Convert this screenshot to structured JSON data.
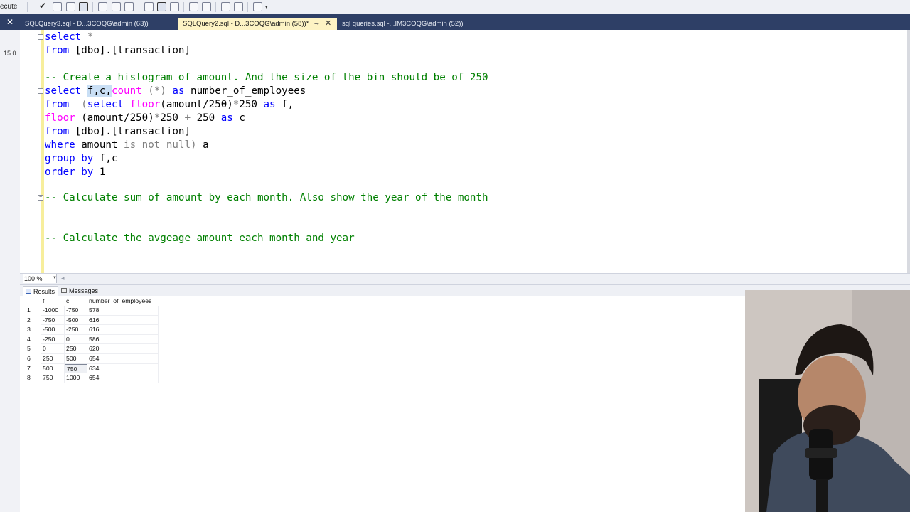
{
  "toolbar": {
    "execute_label": "ecute",
    "icons": [
      "checkmark-icon",
      "debug-icon",
      "stop-icon",
      "parse-icon",
      "display-plan-icon",
      "query-options-icon",
      "results-to-text-icon",
      "results-to-grid-icon",
      "results-to-file-icon",
      "comment-icon",
      "uncomment-icon",
      "indent-icon",
      "outdent-icon",
      "specify-values-icon"
    ]
  },
  "tabs": [
    {
      "label": "SQLQuery3.sql - D...3COQG\\admin (63))",
      "active": false
    },
    {
      "label": "SQLQuery2.sql - D...3COQG\\admin (58))*",
      "active": true
    },
    {
      "label": "sql queries.sql -...IM3COQG\\admin (52))",
      "active": false
    }
  ],
  "gutter": {
    "version_text": "15.0"
  },
  "editor": {
    "lines": {
      "l1_kw": "select",
      "l1_rest": " *",
      "l2_kw": "from",
      "l2_rest": " [dbo].[transaction]",
      "l4_comment": "-- Create a histogram of amount. And the size of the bin should be of 250",
      "l5_kw": "select",
      "l5_sel": "f,c,",
      "l5_fn": "count",
      "l5_star": " (*)",
      "l5_as": " as",
      "l5_rest": " number_of_employees",
      "l6_kw": "from",
      "l6_a": "  (",
      "l6_kw2": "select",
      "l6_fn": " floor",
      "l6_b": "(amount/250)",
      "l6_c": "*",
      "l6_d": "250",
      "l6_as": " as",
      "l6_e": " f,",
      "l7_fn": "floor",
      "l7_a": " (amount/250)",
      "l7_b": "*",
      "l7_c": "250",
      "l7_d": " +",
      "l7_e": " 250",
      "l7_as": " as",
      "l7_f": " c",
      "l8_kw": "from",
      "l8_rest": " [dbo].[transaction]",
      "l9_kw": "where",
      "l9_a": " amount",
      "l9_gr": " is not null",
      "l9_b": ")",
      "l9_c": " a",
      "l10_kw": "group by",
      "l10_rest": " f,c",
      "l11_kw": "order by",
      "l11_rest": " 1",
      "l13_comment": "-- Calculate sum of amount by each month. Also show the year of the month",
      "l16_comment": "-- Calculate the avgeage amount each month and year"
    }
  },
  "zoom": {
    "value": "100 %"
  },
  "result_tabs": {
    "results": "Results",
    "messages": "Messages"
  },
  "grid": {
    "columns": [
      "f",
      "c",
      "number_of_employees"
    ],
    "rows": [
      {
        "n": "1",
        "f": "-1000",
        "c": "-750",
        "v": "578"
      },
      {
        "n": "2",
        "f": "-750",
        "c": "-500",
        "v": "616"
      },
      {
        "n": "3",
        "f": "-500",
        "c": "-250",
        "v": "616"
      },
      {
        "n": "4",
        "f": "-250",
        "c": "0",
        "v": "586"
      },
      {
        "n": "5",
        "f": "0",
        "c": "250",
        "v": "620"
      },
      {
        "n": "6",
        "f": "250",
        "c": "500",
        "v": "654"
      },
      {
        "n": "7",
        "f": "500",
        "c": "750",
        "v": "634"
      },
      {
        "n": "8",
        "f": "750",
        "c": "1000",
        "v": "654"
      }
    ]
  },
  "colors": {
    "keyword": "#0000ff",
    "function": "#ff00ff",
    "comment": "#008000",
    "operator": "#808080",
    "tab_bar": "#2e3f66",
    "active_tab": "#fdf3c4"
  }
}
